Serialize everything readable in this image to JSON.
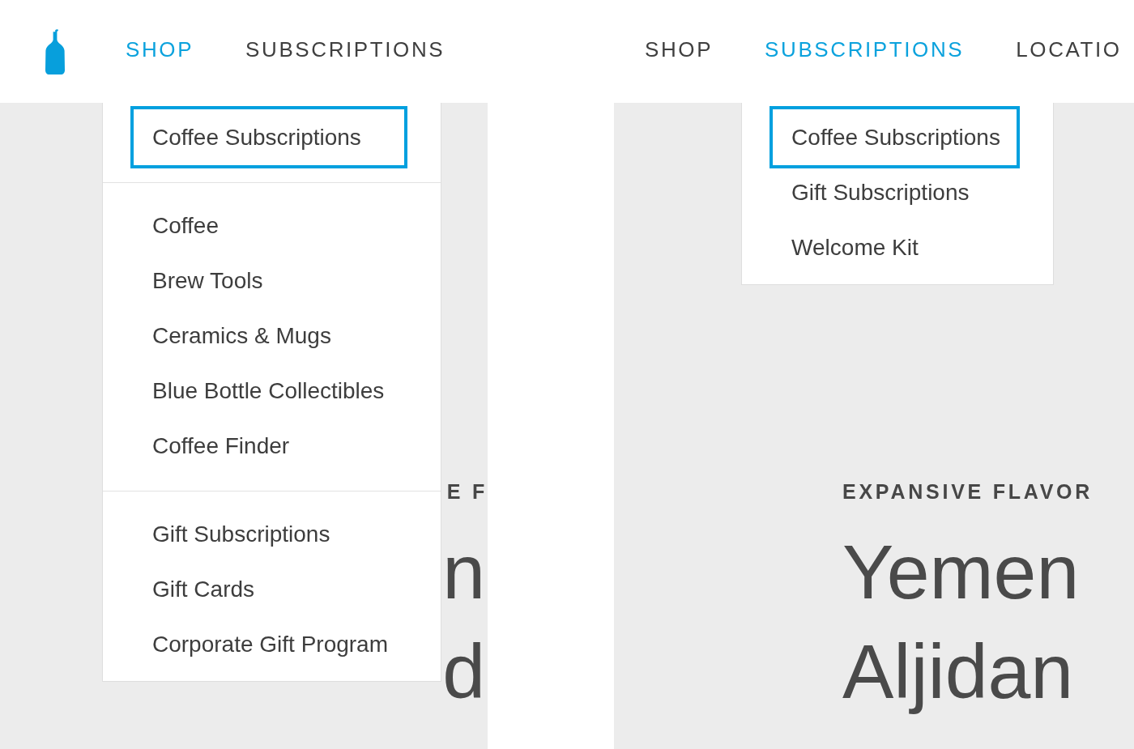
{
  "panels": [
    {
      "logo": true,
      "nav": [
        {
          "label": "SHOP",
          "selected": true
        },
        {
          "label": "SUBSCRIPTIONS",
          "selected": false
        }
      ],
      "dropdown": {
        "sections": [
          [
            {
              "label": "Coffee Subscriptions",
              "highlighted": true
            }
          ],
          [
            {
              "label": "Coffee",
              "highlighted": false
            },
            {
              "label": "Brew Tools",
              "highlighted": false
            },
            {
              "label": "Ceramics & Mugs",
              "highlighted": false
            },
            {
              "label": "Blue Bottle Collectibles",
              "highlighted": false
            },
            {
              "label": "Coffee Finder",
              "highlighted": false
            }
          ],
          [
            {
              "label": "Gift Subscriptions",
              "highlighted": false
            },
            {
              "label": "Gift Cards",
              "highlighted": false
            },
            {
              "label": "Corporate Gift Program",
              "highlighted": false
            }
          ]
        ]
      },
      "hero": {
        "eyebrow": "E F",
        "title_lines": [
          "n",
          "d"
        ]
      }
    },
    {
      "nav": [
        {
          "label": "SHOP",
          "selected": false
        },
        {
          "label": "SUBSCRIPTIONS",
          "selected": true
        },
        {
          "label": "LOCATIO",
          "selected": false
        }
      ],
      "dropdown": {
        "sections": [
          [
            {
              "label": "Coffee Subscriptions",
              "highlighted": true
            },
            {
              "label": "Gift Subscriptions",
              "highlighted": false
            },
            {
              "label": "Welcome Kit",
              "highlighted": false
            }
          ]
        ]
      },
      "hero": {
        "eyebrow": "EXPANSIVE FLAVOR",
        "title_lines": [
          "Yemen",
          "Aljidan"
        ]
      }
    }
  ]
}
